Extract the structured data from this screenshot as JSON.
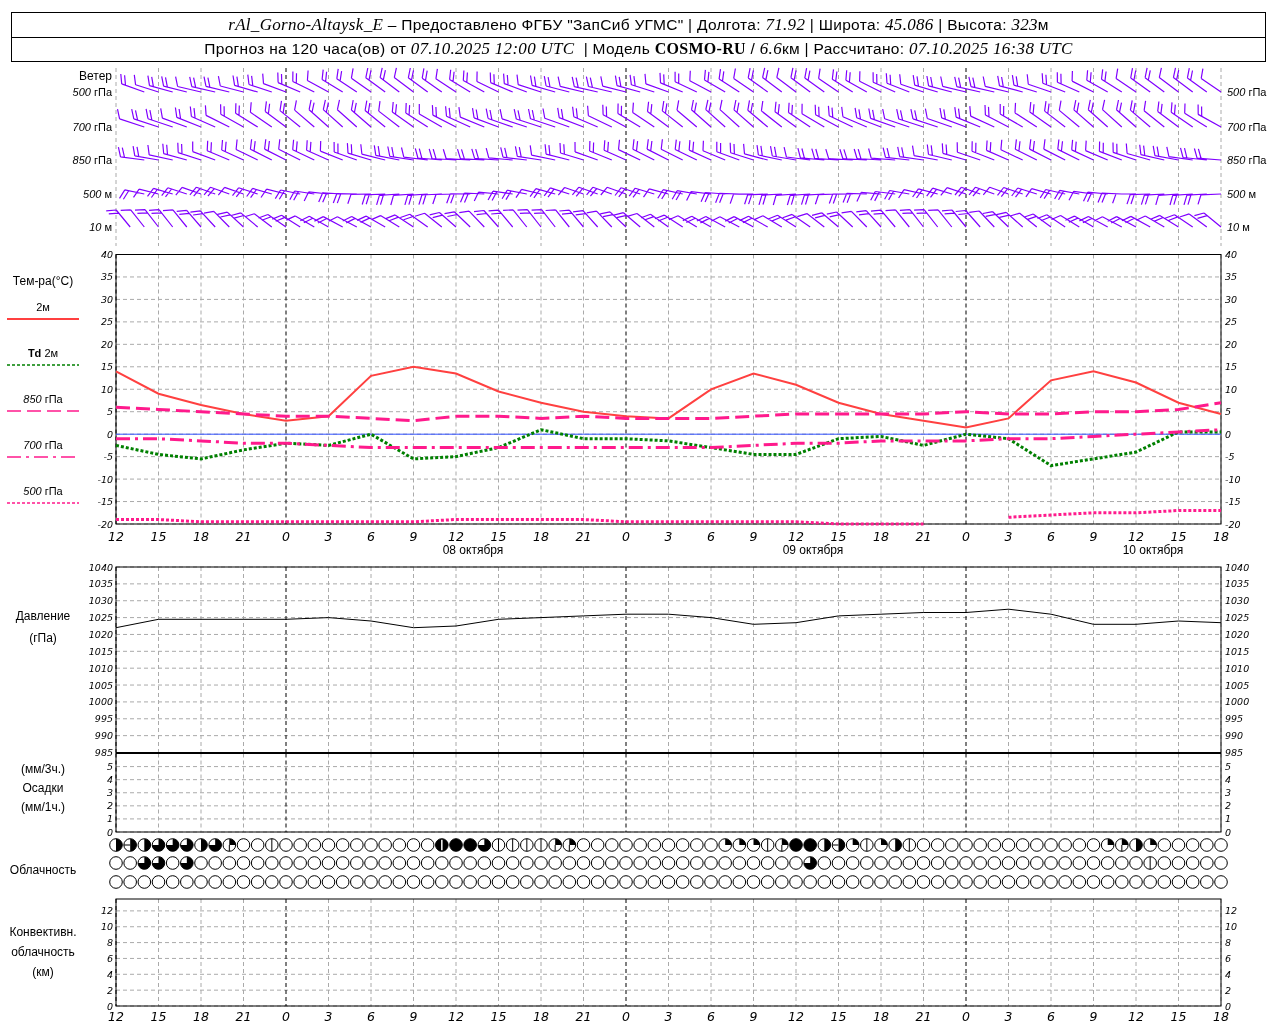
{
  "header": {
    "line_1": [
      {
        "text": "rAl_Gorno-Altaysk_E",
        "kind": "italic"
      },
      {
        "text": " – Предоставлено ФГБУ \"ЗапСиб УГМС\" | Долгота: ",
        "kind": "plain"
      },
      {
        "text": "71.92",
        "kind": "italic"
      },
      {
        "text": " | Широта: ",
        "kind": "plain"
      },
      {
        "text": "45.086",
        "kind": "italic"
      },
      {
        "text": " | Высота: ",
        "kind": "plain"
      },
      {
        "text": "323",
        "kind": "italic"
      },
      {
        "text": "м",
        "kind": "plain"
      }
    ],
    "line_2": [
      {
        "text": "Прогноз на 120 часа(ов) от ",
        "kind": "plain"
      },
      {
        "text": "07.10.2025 12:00 UTC",
        "kind": "italic"
      },
      {
        "text": "  | Модель ",
        "kind": "plain"
      },
      {
        "text": "COSMO-RU",
        "kind": "bold"
      },
      {
        "text": " / ",
        "kind": "plain"
      },
      {
        "text": "6.6",
        "kind": "italic"
      },
      {
        "text": "км | Рассчитано: ",
        "kind": "plain"
      },
      {
        "text": "07.10.2025 16:38 UTC",
        "kind": "italic"
      }
    ]
  },
  "wind": {
    "title": "Ветер",
    "levels": [
      {
        "value": "500",
        "unit": "гПа",
        "right_value": "500",
        "right_unit": "гПа"
      },
      {
        "value": "700",
        "unit": "гПа",
        "right_value": "700",
        "right_unit": "гПа"
      },
      {
        "value": "850",
        "unit": "гПа",
        "right_value": "850",
        "right_unit": "гПа"
      },
      {
        "value": "500",
        "unit": "м",
        "right_value": "500",
        "right_unit": "м"
      },
      {
        "value": "10",
        "unit": "м",
        "right_value": "10",
        "right_unit": "м"
      }
    ]
  },
  "temperature": {
    "right_ticks": [
      "40",
      "35",
      "30",
      "25",
      "20",
      "15",
      "10",
      "5",
      "0",
      "-5",
      "-10",
      "-15",
      "-20"
    ],
    "dates": [
      "08 октября",
      "09 октября",
      "10 октября"
    ],
    "chart_data": {
      "type": "line",
      "ylabel": "Тем-ра(°C)",
      "grid": true,
      "categories": [
        "12",
        "15",
        "18",
        "21",
        "0",
        "3",
        "6",
        "9",
        "12",
        "15",
        "18",
        "21",
        "0",
        "3",
        "6",
        "9",
        "12",
        "15",
        "18",
        "21",
        "0",
        "3",
        "6",
        "9",
        "12",
        "15",
        "18"
      ],
      "ylim": [
        -20,
        40
      ],
      "yticks": [
        -20,
        -15,
        -10,
        -5,
        0,
        5,
        10,
        15,
        20,
        25,
        30,
        35,
        40
      ],
      "series": [
        {
          "name": "2м",
          "color": "#ff4040",
          "line_style": "solid",
          "values": [
            14,
            9,
            6.5,
            4.5,
            3,
            4,
            13,
            15,
            13.5,
            9.5,
            7,
            5,
            4,
            3.5,
            10,
            13.5,
            11,
            7,
            4.5,
            3,
            1.5,
            3.5,
            12,
            14,
            11.5,
            7,
            4.5
          ]
        },
        {
          "name": "**Td** 2м",
          "color": "#008000",
          "line_style": "dotted",
          "values": [
            -2.5,
            -4.5,
            -5.5,
            -3.5,
            -2,
            -2.5,
            0,
            -5.5,
            -5,
            -3,
            1,
            -1,
            -1,
            -1.5,
            -3,
            -4.5,
            -4.5,
            -1,
            -0.5,
            -2.5,
            0,
            -1,
            -7,
            -5.5,
            -4,
            0.5,
            0.5
          ]
        },
        {
          "name": "*850* гПа",
          "color": "#ff1a8c",
          "line_style": "dashed",
          "values": [
            6,
            5.5,
            5,
            4.5,
            4,
            4,
            3.5,
            3,
            4,
            4,
            3.5,
            4,
            3.5,
            3.5,
            3.5,
            4,
            4.5,
            4.5,
            4.5,
            4.5,
            5,
            4.5,
            4.5,
            5,
            5,
            5.5,
            7
          ]
        },
        {
          "name": "*700* гПа",
          "color": "#ff1a8c",
          "line_style": "dashdot",
          "values": [
            -1,
            -1,
            -1.5,
            -2,
            -2,
            -2.5,
            -3,
            -3,
            -3,
            -3,
            -3,
            -3,
            -3,
            -3,
            -3,
            -2.5,
            -2,
            -2,
            -1.5,
            -1.5,
            -1.5,
            -1,
            -1,
            -0.5,
            0,
            0.5,
            1
          ]
        },
        {
          "name": "*500* гПа",
          "color": "#ff1a8c",
          "line_style": "dotted",
          "values": [
            -19,
            -19,
            -19.5,
            -19.5,
            -19.5,
            -19.5,
            -19.5,
            -19.5,
            -19,
            -19,
            -19,
            -19,
            -19.5,
            -19.5,
            -19.5,
            -19.5,
            -19.5,
            -20,
            -20,
            -20,
            null,
            -18.5,
            -18,
            -17.5,
            -17.5,
            -17,
            -17
          ]
        },
        {
          "color": "#3050ff",
          "line_style": "solid",
          "values": [
            0,
            0,
            0,
            0,
            0,
            0,
            0,
            0,
            0,
            0,
            0,
            0,
            0,
            0,
            0,
            0,
            0,
            0,
            0,
            0,
            0,
            0,
            0,
            0,
            0,
            0,
            0
          ]
        }
      ]
    }
  },
  "pressure": {
    "right_ticks": [
      "1040",
      "1035",
      "1030",
      "1025",
      "1020",
      "1015",
      "1010",
      "1005",
      "1000",
      "995",
      "990",
      "985"
    ],
    "chart_data": {
      "type": "line",
      "ylabel": "Давление\n(гПа)",
      "grid": true,
      "ylim": [
        985,
        1040
      ],
      "yticks": [
        985,
        990,
        995,
        1000,
        1005,
        1010,
        1015,
        1020,
        1025,
        1030,
        1035,
        1040
      ],
      "series": [
        {
          "color": "#000000",
          "values": [
            1022,
            1024.5,
            1024.5,
            1024.5,
            1024.5,
            1025,
            1024,
            1022,
            1022.5,
            1024.5,
            1025,
            1025.5,
            1026,
            1026,
            1025,
            1023,
            1023.5,
            1025.5,
            1026,
            1026.5,
            1026.5,
            1027.5,
            1026,
            1023,
            1023,
            1024,
            1023.5
          ]
        }
      ]
    }
  },
  "precipitation": {
    "right_ticks": [
      "5",
      "4",
      "3",
      "2",
      "1",
      "0"
    ],
    "chart_data": {
      "type": "bar",
      "ylabel": "(мм/3ч.)\nОсадки\n(мм/1ч.)",
      "grid": true,
      "ylim": [
        0,
        6
      ],
      "yticks": [
        0,
        1,
        2,
        3,
        4,
        5
      ],
      "values": [
        0,
        0,
        0,
        0,
        0,
        0,
        0,
        0,
        0,
        0,
        0,
        0,
        0,
        0,
        0,
        0,
        0,
        0,
        0,
        0,
        0,
        0,
        0,
        0,
        0,
        0,
        0
      ]
    }
  },
  "cloudiness": {
    "label": "Облачность",
    "rows": [
      {
        "cells": [
          {
            "kind": "okta4"
          },
          {
            "kind": "okta5"
          },
          {
            "kind": "okta4"
          },
          {
            "kind": "okta6"
          },
          {
            "kind": "okta6"
          },
          {
            "kind": "okta6"
          },
          {
            "kind": "okta4"
          },
          {
            "kind": "okta6"
          },
          {
            "kind": "okta3"
          },
          {
            "kind": "okta0"
          },
          {
            "kind": "okta0"
          },
          {
            "kind": "okta1"
          },
          {
            "kind": "okta0"
          },
          {
            "kind": "okta0"
          },
          {
            "kind": "okta0"
          },
          {
            "kind": "okta0"
          },
          {
            "kind": "okta0"
          },
          {
            "kind": "okta0"
          },
          {
            "kind": "okta0"
          },
          {
            "kind": "okta0"
          },
          {
            "kind": "okta0"
          },
          {
            "kind": "okta0"
          },
          {
            "kind": "okta0"
          },
          {
            "kind": "okta7"
          },
          {
            "kind": "okta8"
          },
          {
            "kind": "okta8"
          },
          {
            "kind": "okta6"
          },
          {
            "kind": "okta1"
          },
          {
            "kind": "okta1"
          },
          {
            "kind": "okta1"
          },
          {
            "kind": "okta1"
          },
          {
            "kind": "okta3"
          },
          {
            "kind": "okta3"
          },
          {
            "kind": "okta0"
          },
          {
            "kind": "okta0"
          },
          {
            "kind": "okta0"
          },
          {
            "kind": "okta0"
          },
          {
            "kind": "okta0"
          },
          {
            "kind": "okta0"
          },
          {
            "kind": "okta0"
          },
          {
            "kind": "okta0"
          },
          {
            "kind": "okta0"
          },
          {
            "kind": "okta0"
          },
          {
            "kind": "okta2"
          },
          {
            "kind": "okta2"
          },
          {
            "kind": "okta2"
          },
          {
            "kind": "okta1"
          },
          {
            "kind": "okta3"
          },
          {
            "kind": "okta8"
          },
          {
            "kind": "okta8"
          },
          {
            "kind": "okta4"
          },
          {
            "kind": "okta5"
          },
          {
            "kind": "okta2"
          },
          {
            "kind": "okta1"
          },
          {
            "kind": "okta2"
          },
          {
            "kind": "okta4"
          },
          {
            "kind": "okta1"
          },
          {
            "kind": "okta0"
          },
          {
            "kind": "okta0"
          },
          {
            "kind": "okta0"
          },
          {
            "kind": "okta0"
          },
          {
            "kind": "okta0"
          },
          {
            "kind": "okta0"
          },
          {
            "kind": "okta0"
          },
          {
            "kind": "okta0"
          },
          {
            "kind": "okta0"
          },
          {
            "kind": "okta0"
          },
          {
            "kind": "okta0"
          },
          {
            "kind": "okta0"
          },
          {
            "kind": "okta0"
          },
          {
            "kind": "okta2"
          },
          {
            "kind": "okta3"
          },
          {
            "kind": "okta4"
          },
          {
            "kind": "okta2"
          },
          {
            "kind": "okta0"
          },
          {
            "kind": "okta0"
          },
          {
            "kind": "okta0"
          },
          {
            "kind": "okta0"
          },
          {
            "kind": "okta0"
          }
        ]
      },
      {
        "cells": [
          {
            "kind": "okta0"
          },
          {
            "kind": "okta0"
          },
          {
            "kind": "okta6"
          },
          {
            "kind": "okta6"
          },
          {
            "kind": "okta0"
          },
          {
            "kind": "okta6"
          },
          {
            "kind": "okta0"
          },
          {
            "kind": "okta0"
          },
          {
            "kind": "okta0"
          },
          {
            "kind": "okta0"
          },
          {
            "kind": "okta0"
          },
          {
            "kind": "okta0"
          },
          {
            "kind": "okta0"
          },
          {
            "kind": "okta0"
          },
          {
            "kind": "okta0"
          },
          {
            "kind": "okta0"
          },
          {
            "kind": "okta0"
          },
          {
            "kind": "okta0"
          },
          {
            "kind": "okta0"
          },
          {
            "kind": "okta0"
          },
          {
            "kind": "okta0"
          },
          {
            "kind": "okta0"
          },
          {
            "kind": "okta0"
          },
          {
            "kind": "okta0"
          },
          {
            "kind": "okta0"
          },
          {
            "kind": "okta0"
          },
          {
            "kind": "okta0"
          },
          {
            "kind": "okta0"
          },
          {
            "kind": "okta0"
          },
          {
            "kind": "okta0"
          },
          {
            "kind": "okta0"
          },
          {
            "kind": "okta0"
          },
          {
            "kind": "okta0"
          },
          {
            "kind": "okta0"
          },
          {
            "kind": "okta0"
          },
          {
            "kind": "okta0"
          },
          {
            "kind": "okta0"
          },
          {
            "kind": "okta0"
          },
          {
            "kind": "okta0"
          },
          {
            "kind": "okta0"
          },
          {
            "kind": "okta0"
          },
          {
            "kind": "okta0"
          },
          {
            "kind": "okta0"
          },
          {
            "kind": "okta0"
          },
          {
            "kind": "okta0"
          },
          {
            "kind": "okta0"
          },
          {
            "kind": "okta0"
          },
          {
            "kind": "okta0"
          },
          {
            "kind": "okta0"
          },
          {
            "kind": "okta6"
          },
          {
            "kind": "okta0"
          },
          {
            "kind": "okta0"
          },
          {
            "kind": "okta0"
          },
          {
            "kind": "okta0"
          },
          {
            "kind": "okta0"
          },
          {
            "kind": "okta0"
          },
          {
            "kind": "okta0"
          },
          {
            "kind": "okta0"
          },
          {
            "kind": "okta0"
          },
          {
            "kind": "okta0"
          },
          {
            "kind": "okta0"
          },
          {
            "kind": "okta0"
          },
          {
            "kind": "okta0"
          },
          {
            "kind": "okta0"
          },
          {
            "kind": "okta0"
          },
          {
            "kind": "okta0"
          },
          {
            "kind": "okta0"
          },
          {
            "kind": "okta0"
          },
          {
            "kind": "okta0"
          },
          {
            "kind": "okta0"
          },
          {
            "kind": "okta0"
          },
          {
            "kind": "okta0"
          },
          {
            "kind": "okta0"
          },
          {
            "kind": "okta1"
          },
          {
            "kind": "okta0"
          },
          {
            "kind": "okta0"
          },
          {
            "kind": "okta0"
          },
          {
            "kind": "okta0"
          },
          {
            "kind": "okta0"
          }
        ]
      },
      {
        "cells": [
          {
            "kind": "okta0"
          },
          {
            "kind": "okta0"
          },
          {
            "kind": "okta0"
          },
          {
            "kind": "okta0"
          },
          {
            "kind": "okta0"
          },
          {
            "kind": "okta0"
          },
          {
            "kind": "okta0"
          },
          {
            "kind": "okta0"
          },
          {
            "kind": "okta0"
          },
          {
            "kind": "okta0"
          },
          {
            "kind": "okta0"
          },
          {
            "kind": "okta0"
          },
          {
            "kind": "okta0"
          },
          {
            "kind": "okta0"
          },
          {
            "kind": "okta0"
          },
          {
            "kind": "okta0"
          },
          {
            "kind": "okta0"
          },
          {
            "kind": "okta0"
          },
          {
            "kind": "okta0"
          },
          {
            "kind": "okta0"
          },
          {
            "kind": "okta0"
          },
          {
            "kind": "okta0"
          },
          {
            "kind": "okta0"
          },
          {
            "kind": "okta0"
          },
          {
            "kind": "okta0"
          },
          {
            "kind": "okta0"
          },
          {
            "kind": "okta0"
          },
          {
            "kind": "okta0"
          },
          {
            "kind": "okta0"
          },
          {
            "kind": "okta0"
          },
          {
            "kind": "okta0"
          },
          {
            "kind": "okta0"
          },
          {
            "kind": "okta0"
          },
          {
            "kind": "okta0"
          },
          {
            "kind": "okta0"
          },
          {
            "kind": "okta0"
          },
          {
            "kind": "okta0"
          },
          {
            "kind": "okta0"
          },
          {
            "kind": "okta0"
          },
          {
            "kind": "okta0"
          },
          {
            "kind": "okta0"
          },
          {
            "kind": "okta0"
          },
          {
            "kind": "okta0"
          },
          {
            "kind": "okta0"
          },
          {
            "kind": "okta0"
          },
          {
            "kind": "okta0"
          },
          {
            "kind": "okta0"
          },
          {
            "kind": "okta0"
          },
          {
            "kind": "okta0"
          },
          {
            "kind": "okta0"
          },
          {
            "kind": "okta0"
          },
          {
            "kind": "okta0"
          },
          {
            "kind": "okta0"
          },
          {
            "kind": "okta0"
          },
          {
            "kind": "okta0"
          },
          {
            "kind": "okta0"
          },
          {
            "kind": "okta0"
          },
          {
            "kind": "okta0"
          },
          {
            "kind": "okta0"
          },
          {
            "kind": "okta0"
          },
          {
            "kind": "okta0"
          },
          {
            "kind": "okta0"
          },
          {
            "kind": "okta0"
          },
          {
            "kind": "okta0"
          },
          {
            "kind": "okta0"
          },
          {
            "kind": "okta0"
          },
          {
            "kind": "okta0"
          },
          {
            "kind": "okta0"
          },
          {
            "kind": "okta0"
          },
          {
            "kind": "okta0"
          },
          {
            "kind": "okta0"
          },
          {
            "kind": "okta0"
          },
          {
            "kind": "okta0"
          },
          {
            "kind": "okta0"
          },
          {
            "kind": "okta0"
          },
          {
            "kind": "okta0"
          },
          {
            "kind": "okta0"
          },
          {
            "kind": "okta0"
          },
          {
            "kind": "okta0"
          }
        ]
      }
    ]
  },
  "convective": {
    "right_ticks": [
      "12",
      "10",
      "8",
      "6",
      "4",
      "2",
      "0"
    ],
    "chart_data": {
      "type": "bar",
      "ylabel": "Конвективн.\nоблачность\n(км)",
      "grid": true,
      "categories": [
        "12",
        "15",
        "18",
        "21",
        "0",
        "3",
        "6",
        "9",
        "12",
        "15",
        "18",
        "21",
        "0",
        "3",
        "6",
        "9",
        "12",
        "15",
        "18",
        "21",
        "0",
        "3",
        "6",
        "9",
        "12",
        "15",
        "18"
      ],
      "ylim": [
        0,
        13.5
      ],
      "yticks": [
        0,
        2,
        4,
        6,
        8,
        10,
        12
      ],
      "values": [
        0,
        0,
        0,
        0,
        0,
        0,
        0,
        0,
        0,
        0,
        0,
        0,
        0,
        0,
        0,
        0,
        0,
        0,
        0,
        0,
        0,
        0,
        0,
        0,
        0,
        0,
        0
      ]
    }
  }
}
